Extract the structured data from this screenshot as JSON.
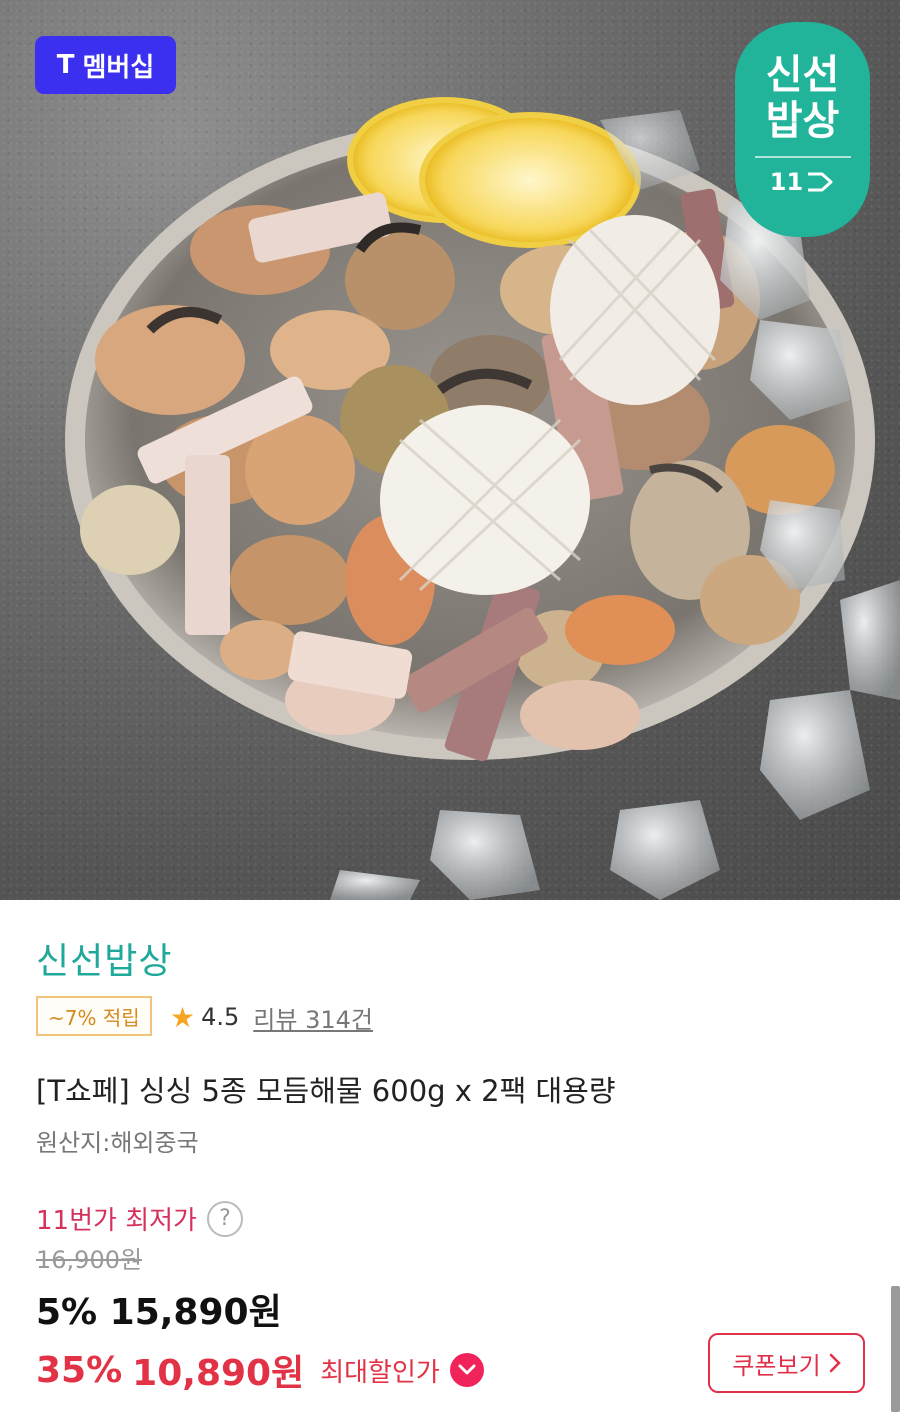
{
  "hero": {
    "membership_badge": {
      "icon": "t-logo-icon",
      "mark": "T",
      "label": "멤버십",
      "color": "#3b2ff0"
    },
    "brand_badge": {
      "line1": "신선",
      "line2": "밥상",
      "logo": "11",
      "icon": "arrow-logo-icon",
      "color": "#22b49a"
    },
    "image_alt_icon": "seafood-plate-image"
  },
  "product": {
    "seller": "신선밥상",
    "points_badge": "~7% 적립",
    "rating": {
      "icon": "star-icon",
      "score": "4.5",
      "reviews": "리뷰 314건"
    },
    "title": "[T쇼페] 싱싱 5종 모듬해물 600g x 2팩 대용량",
    "origin": "원산지:해외중국"
  },
  "pricing": {
    "lowest_label": "11번가 최저가",
    "help_icon": "?",
    "original_price": "16,900원",
    "sale_price": "5% 15,890원",
    "max_discount_pct": "35%",
    "max_price": "10,890원",
    "max_label": "최대할인가",
    "coupon_button": "쿠폰보기"
  },
  "colors": {
    "accent_green": "#20a99a",
    "price_red": "#e23246",
    "points_orange": "#d48a1c"
  }
}
